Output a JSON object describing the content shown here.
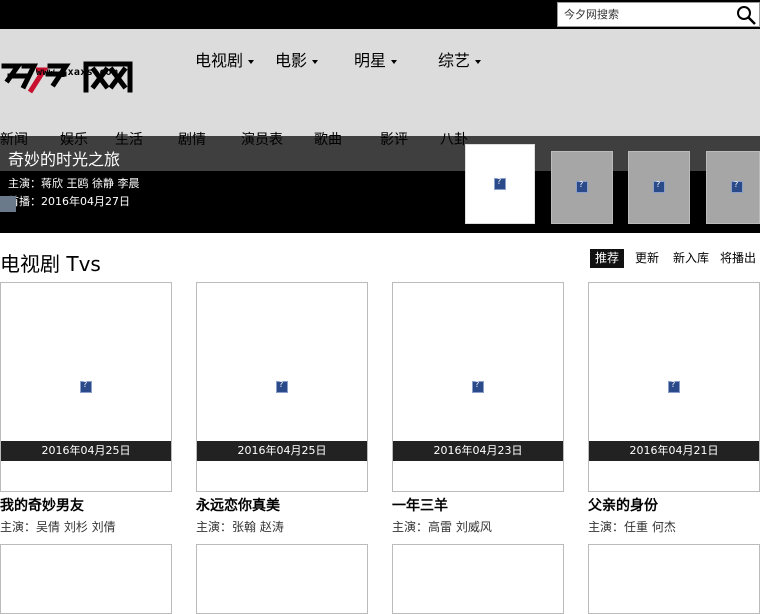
{
  "search": {
    "placeholder": "今夕网搜索"
  },
  "logo": {
    "url_text": "www.jxaxs.com"
  },
  "main_nav": [
    {
      "label": "电视剧"
    },
    {
      "label": "电影"
    },
    {
      "label": "明星"
    },
    {
      "label": "综艺"
    }
  ],
  "sub_nav": [
    {
      "label": "新闻"
    },
    {
      "label": "娱乐"
    },
    {
      "label": "生活"
    },
    {
      "label": "剧情"
    },
    {
      "label": "演员表"
    },
    {
      "label": "歌曲"
    },
    {
      "label": "影评"
    },
    {
      "label": "八卦"
    }
  ],
  "banner": {
    "title": "奇妙的时光之旅",
    "cast": "主演：蒋欣 王鸥 徐静 李晨",
    "date": "首播：2016年04月27日"
  },
  "section": {
    "title": "电视剧 Tvs",
    "tabs": [
      {
        "label": "推荐",
        "active": true
      },
      {
        "label": "更新",
        "active": false
      },
      {
        "label": "新入库",
        "active": false
      },
      {
        "label": "将播出",
        "active": false
      }
    ]
  },
  "cards": [
    {
      "date": "2016年04月25日",
      "title": "我的奇妙男友",
      "cast": "主演：吴倩 刘杉 刘倩"
    },
    {
      "date": "2016年04月25日",
      "title": "永远恋你真美",
      "cast": "主演：张翰 赵涛"
    },
    {
      "date": "2016年04月23日",
      "title": "一年三羊",
      "cast": "主演：高雷 刘威风"
    },
    {
      "date": "2016年04月21日",
      "title": "父亲的身份",
      "cast": "主演：任重 何杰"
    }
  ],
  "colors": {
    "topbar": "#000000",
    "header": "#dcdcdc",
    "logo_red": "#c8102e"
  }
}
